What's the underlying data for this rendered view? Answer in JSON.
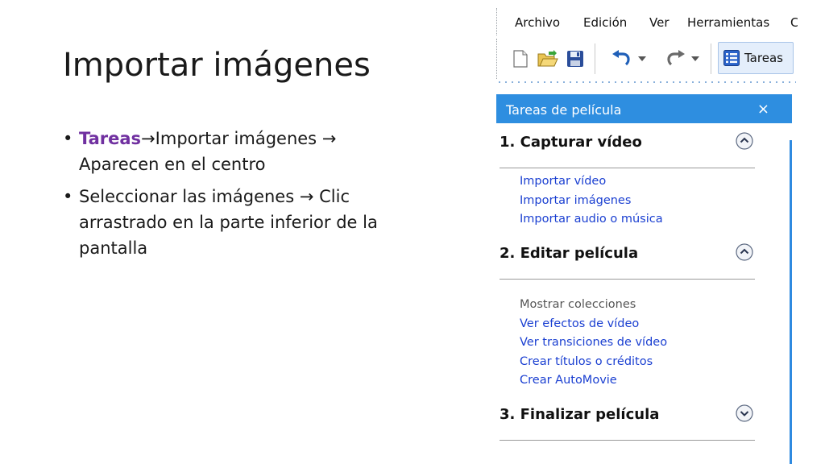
{
  "slide": {
    "title": "Importar imágenes",
    "bullets": [
      {
        "accent": "Tareas",
        "arrow1": "→",
        "text1": "Importar imágenes ",
        "arrow2": "→",
        "text2": " Aparecen en el centro"
      },
      {
        "text1": "Seleccionar las imágenes ",
        "arrow1": "→",
        "text2": " Clic arrastrado en la parte inferior de la pantalla"
      }
    ]
  },
  "app": {
    "menubar": {
      "items": [
        "Archivo",
        "Edición",
        "Ver",
        "Herramientas",
        "C"
      ]
    },
    "toolbar": {
      "tasks_button_label": "Tareas"
    },
    "tasks_panel": {
      "title": "Tareas de película",
      "close_glyph": "×",
      "sections": [
        {
          "title": "1. Capturar vídeo",
          "links": [
            "Importar vídeo",
            "Importar imágenes",
            "Importar audio o música"
          ]
        },
        {
          "title": "2. Editar película",
          "muted_item": "Mostrar colecciones",
          "links": [
            "Ver efectos de vídeo",
            "Ver transiciones de vídeo",
            "Crear títulos o créditos",
            "Crear AutoMovie"
          ]
        },
        {
          "title": "3. Finalizar película"
        }
      ]
    },
    "icons": {
      "new": "new-document-icon",
      "open": "open-folder-icon",
      "save": "save-disk-icon",
      "undo": "undo-icon",
      "redo": "redo-icon",
      "tasks": "tasks-list-icon",
      "collapse": "chevron-up-circle-icon",
      "expand": "chevron-down-circle-icon"
    },
    "colors": {
      "accent_purple": "#7030a0",
      "header_blue": "#2e8ee0",
      "link_blue": "#1a3fd1"
    }
  }
}
